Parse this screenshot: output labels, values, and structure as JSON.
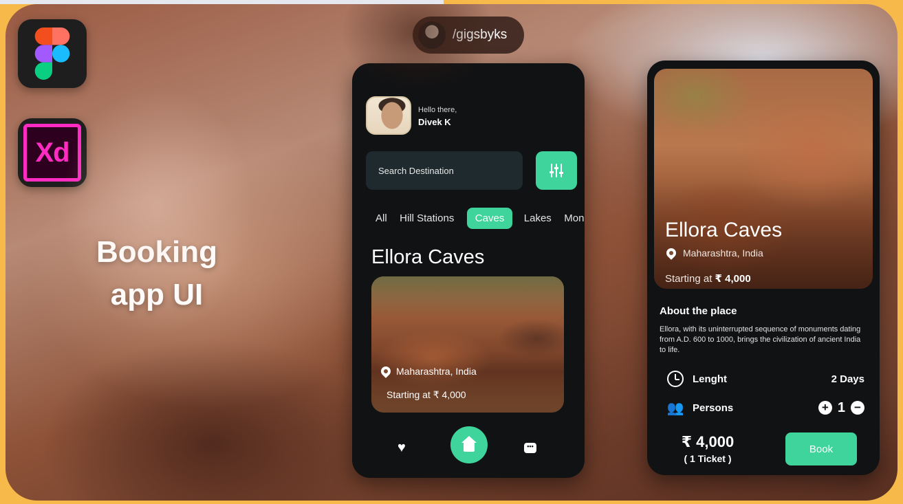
{
  "headline": {
    "line1": "Booking",
    "line2": "app UI"
  },
  "tools": {
    "figma_icon": "figma-logo",
    "xd_label": "Xd"
  },
  "handle": {
    "text": "/gigsbyks"
  },
  "home_screen": {
    "greeting": "Hello there,",
    "user_name": "Divek K",
    "search_placeholder": "Search Destination",
    "filter_icon": "sliders-icon",
    "categories": [
      {
        "label": "All",
        "active": false
      },
      {
        "label": "Hill Stations",
        "active": false
      },
      {
        "label": "Caves",
        "active": true
      },
      {
        "label": "Lakes",
        "active": false
      },
      {
        "label": "Monuments",
        "active": false
      }
    ],
    "section_title": "Ellora Caves",
    "card": {
      "location": "Maharashtra, India",
      "price": "Starting at ₹ 4,000"
    },
    "nav": {
      "heart_icon": "heart-icon",
      "home_icon": "home-icon",
      "chat_icon": "chat-icon",
      "chat_glyph": "•••"
    },
    "accent_color": "#3ed49b"
  },
  "detail_screen": {
    "title": "Ellora Caves",
    "location": "Maharashtra, India",
    "price_prefix": "Starting at",
    "price_value": "₹ 4,000",
    "about_heading": "About the place",
    "about_text": "Ellora, with its uninterrupted sequence of monuments dating from A.D. 600 to 1000, brings the civilization of ancient India to life.",
    "length_label": "Lenght",
    "length_value": "2 Days",
    "persons_label": "Persons",
    "persons_value": "1",
    "plus": "+",
    "minus": "−",
    "total_price": "₹ 4,000",
    "ticket_note": "( 1 Ticket )",
    "book_label": "Book"
  }
}
